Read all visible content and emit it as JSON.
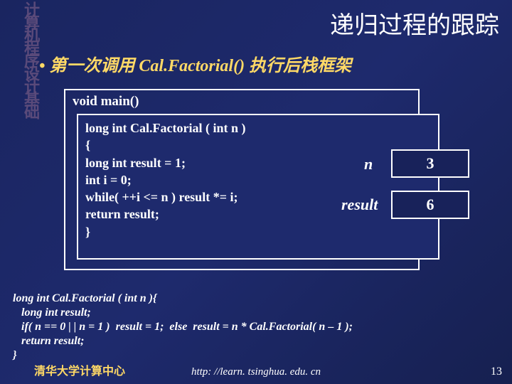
{
  "side_label": "计算机程序设计基础",
  "title": "递归过程的跟踪",
  "subtitle_prefix": "• 第一次调用 ",
  "subtitle_fn": "Cal.Factorial()",
  "subtitle_suffix": " 执行后栈框架",
  "main_decl": "void  main()",
  "inner_code": {
    "l1": "long int Cal.Factorial ( int n )",
    "l2": "{",
    "l3": "  long int result = 1;",
    "l4": "  int i = 0;",
    "l5": "  while( ++i <= n )  result *= i;",
    "l6": "  return result;",
    "l7": "}"
  },
  "vars": {
    "n_label": "n",
    "n_value": "3",
    "result_label": "result",
    "result_value": "6"
  },
  "bottom_code": "long int Cal.Factorial ( int n ){\n   long int result;\n   if( n == 0 | | n = 1 )  result = 1;  else  result = n * Cal.Factorial( n – 1 );\n   return result;\n}",
  "footer_left": "清华大学计算中心",
  "footer_center": "http: //learn. tsinghua. edu. cn",
  "page_num": "13"
}
